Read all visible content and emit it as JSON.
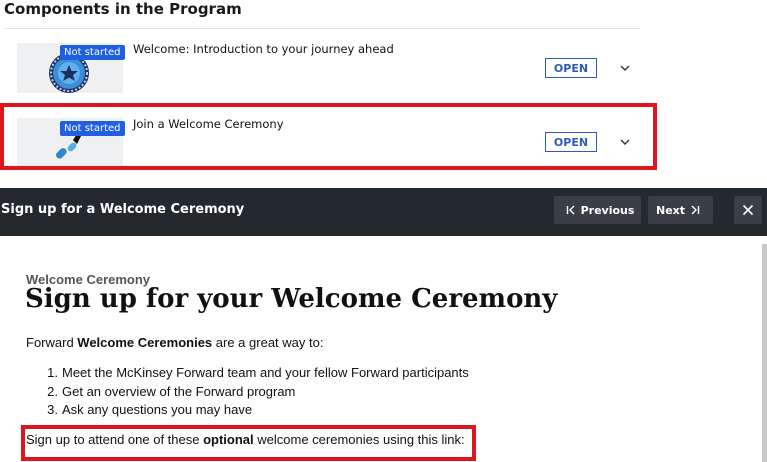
{
  "section": {
    "title": "Components in the Program"
  },
  "components": [
    {
      "badge": "Not started",
      "title": "Welcome: Introduction to your journey ahead",
      "button": "OPEN"
    },
    {
      "badge": "Not started",
      "title": "Join a Welcome Ceremony",
      "button": "OPEN"
    }
  ],
  "modal": {
    "title": "Sign up for a Welcome Ceremony",
    "previous_label": "Previous",
    "next_label": "Next"
  },
  "content": {
    "eyebrow": "Welcome Ceremony",
    "headline": "Sign up for your Welcome Ceremony",
    "intro": {
      "prefix": "Forward ",
      "bold": "Welcome Ceremonies",
      "suffix": " are a great way to:"
    },
    "benefits": [
      "Meet the McKinsey Forward team and your fellow Forward participants",
      "Get an overview of the Forward program",
      "Ask any questions you may have"
    ],
    "benefit_numbers": [
      "1.",
      "2.",
      "3."
    ],
    "signup": {
      "prefix": "Sign up to attend one of these ",
      "bold": "optional",
      "suffix": " welcome ceremonies using this link:"
    }
  },
  "colors": {
    "highlight": "#e0161e",
    "badge": "#1f5fe0",
    "header": "#24292e",
    "open_button": "#2a5db8"
  }
}
